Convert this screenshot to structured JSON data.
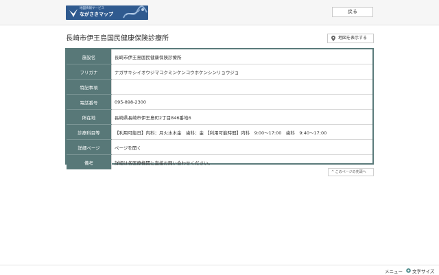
{
  "header": {
    "logo_subtitle": "地図情報サービス",
    "logo_title": "ながさきマップ",
    "back_label": "戻る"
  },
  "page": {
    "title": "長崎市伊王島国民健康保険診療所",
    "map_button_label": "地図を表示する",
    "pagetop_label": "このページの先頭へ"
  },
  "details": [
    {
      "label": "施設名",
      "value": "長崎市伊王島国民健康保険診療所"
    },
    {
      "label": "フリガナ",
      "value": "ナガサキシイオウジマコクミンケンコウホケンシンリョウジョ"
    },
    {
      "label": "特記事項",
      "value": ""
    },
    {
      "label": "電話番号",
      "value": "095-898-2300"
    },
    {
      "label": "所在地",
      "value": "長崎県長崎市伊王島町2丁目846番地6"
    },
    {
      "label": "診療科目等",
      "value": "【利用可能日】内科：月火水木金　歯科：金 【利用可能時間】内科　9:00〜17:00　歯科　9:40〜17:00"
    },
    {
      "label": "詳細ページ",
      "value": "ページを開く"
    },
    {
      "label": "備考",
      "value": "詳細は各医療機関に直接お問い合わせください。"
    }
  ],
  "footer": {
    "menu_label": "メニュー",
    "text_size_label": "文字サイズ"
  },
  "icons": {
    "logo": "bird-icon",
    "map": "map-pin-icon",
    "pagetop": "chevron-up-icon",
    "text_size": "text-size-icon"
  },
  "colors": {
    "logo_bg": "#2f5a8f",
    "table_header_bg": "#587878",
    "table_border": "#5a7a7a"
  }
}
